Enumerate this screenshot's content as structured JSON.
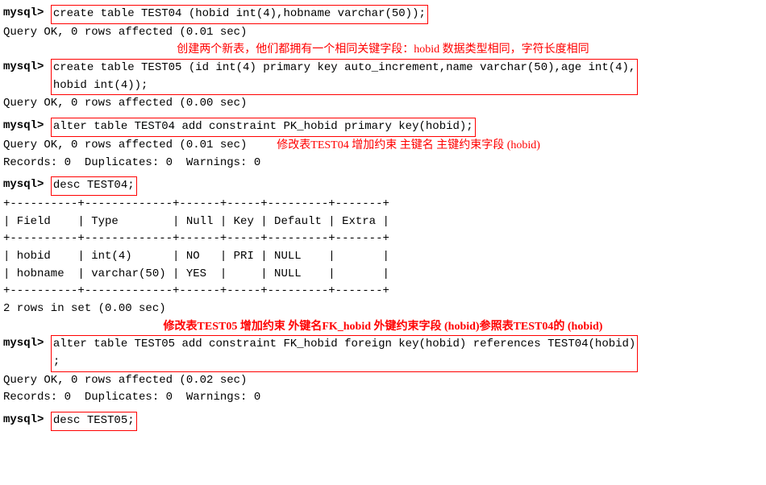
{
  "terminal": {
    "blocks": [
      {
        "type": "command-single",
        "prompt": "mysql> ",
        "cmd": "create table TEST04 (hobid int(4),hobname varchar(50));"
      },
      {
        "type": "output",
        "lines": [
          "Query OK, 0 rows affected (0.01 sec)"
        ]
      },
      {
        "type": "annotation",
        "text": "创建两个新表，他们都拥有一个相同关键字段：hobid 数据类型相同，字符长度相同"
      },
      {
        "type": "command-multi",
        "prompt": "mysql> ",
        "cmd_lines": [
          "create table TEST05 (id int(4) primary key auto_increment,name varchar(50),age int(4),",
          "hobid int(4));"
        ]
      },
      {
        "type": "output",
        "lines": [
          "Query OK, 0 rows affected (0.00 sec)"
        ]
      },
      {
        "type": "blank"
      },
      {
        "type": "command-single",
        "prompt": "mysql> ",
        "cmd": "alter table TEST04 add constraint PK_hobid primary key(hobid);"
      },
      {
        "type": "output",
        "lines": [
          "Query OK, 0 rows affected (0.01 sec)",
          "Records: 0  Duplicates: 0  Warnings: 0"
        ]
      },
      {
        "type": "annotation-right",
        "text": "修改表TEST04 增加约束 主键名 主键约束字段 (hobid)"
      },
      {
        "type": "blank"
      },
      {
        "type": "command-single",
        "prompt": "mysql> ",
        "cmd": "desc TEST04;"
      },
      {
        "type": "table",
        "rows": [
          "+--------+-------------+------+-----+---------+-------+",
          "| Field  | Type        | Null | Key | Default | Extra |",
          "+--------+-------------+------+-----+---------+-------+",
          "| hobid  | int(4)      | NO   | PRI | NULL    |       |",
          "| hobname| varchar(50) | YES  |     | NULL    |       |",
          "+--------+-------------+------+-----+---------+-------+"
        ]
      },
      {
        "type": "output",
        "lines": [
          "2 rows in set (0.00 sec)"
        ]
      },
      {
        "type": "annotation-bold",
        "text": "修改表TEST05 增加约束 外键名FK_hobid 外键约束字段 (hobid)参照表TEST04的 (hobid)"
      },
      {
        "type": "command-multi-box",
        "prompt": "mysql> ",
        "cmd_lines": [
          "alter table TEST05 add constraint FK_hobid foreign key(hobid) references TEST04(hobid)",
          ";"
        ]
      },
      {
        "type": "output",
        "lines": [
          "Query OK, 0 rows affected (0.02 sec)",
          "Records: 0  Duplicates: 0  Warnings: 0"
        ]
      },
      {
        "type": "blank"
      },
      {
        "type": "command-single",
        "prompt": "mysql> ",
        "cmd": "desc TEST05;"
      }
    ]
  }
}
